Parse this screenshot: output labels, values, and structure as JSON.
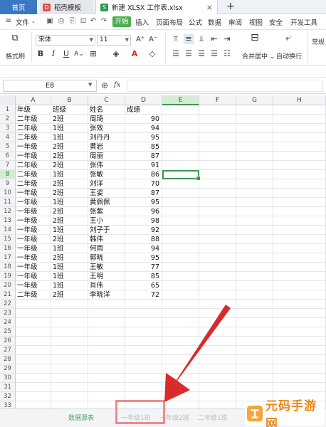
{
  "tabbar": {
    "home": "首页",
    "template": "稻壳模板",
    "file": "新建 XLSX 工作表.xlsx",
    "add": "+"
  },
  "menubar": {
    "file": "文件",
    "start": "开始",
    "items": [
      "插入",
      "页面布局",
      "公式",
      "数据",
      "审阅",
      "视图",
      "安全",
      "开发工具"
    ]
  },
  "ribbon": {
    "format_painter": "格式刷",
    "font_name": "宋体",
    "font_size": "11",
    "merge_center": "合并居中",
    "auto_wrap": "自动换行",
    "normal": "常规"
  },
  "formula_bar": {
    "namebox": "E8",
    "fx": "fx"
  },
  "columns": [
    "A",
    "B",
    "C",
    "D",
    "E",
    "F",
    "G",
    "H"
  ],
  "selected_cell": {
    "col": "E",
    "row": 8
  },
  "rows": [
    {
      "n": "1",
      "a": "年级",
      "b": "班级",
      "c": "姓名",
      "d": "成绩"
    },
    {
      "n": "2",
      "a": "二年级",
      "b": "2班",
      "c": "周琦",
      "d": "90"
    },
    {
      "n": "3",
      "a": "二年级",
      "b": "1班",
      "c": "张效",
      "d": "94"
    },
    {
      "n": "4",
      "a": "二年级",
      "b": "1班",
      "c": "刘丹丹",
      "d": "95"
    },
    {
      "n": "5",
      "a": "一年级",
      "b": "2班",
      "c": "黄岩",
      "d": "85"
    },
    {
      "n": "6",
      "a": "一年级",
      "b": "2班",
      "c": "周丽",
      "d": "87"
    },
    {
      "n": "7",
      "a": "二年级",
      "b": "2班",
      "c": "张伟",
      "d": "91"
    },
    {
      "n": "8",
      "a": "二年级",
      "b": "1班",
      "c": "张敏",
      "d": "86"
    },
    {
      "n": "9",
      "a": "二年级",
      "b": "2班",
      "c": "刘洋",
      "d": "70"
    },
    {
      "n": "10",
      "a": "一年级",
      "b": "2班",
      "c": "王姿",
      "d": "87"
    },
    {
      "n": "11",
      "a": "一年级",
      "b": "1班",
      "c": "黄佩佩",
      "d": "95"
    },
    {
      "n": "12",
      "a": "一年级",
      "b": "2班",
      "c": "张紫",
      "d": "96"
    },
    {
      "n": "13",
      "a": "一年级",
      "b": "2班",
      "c": "王小",
      "d": "98"
    },
    {
      "n": "14",
      "a": "一年级",
      "b": "1班",
      "c": "刘子于",
      "d": "92"
    },
    {
      "n": "15",
      "a": "一年级",
      "b": "2班",
      "c": "韩伟",
      "d": "88"
    },
    {
      "n": "16",
      "a": "一年级",
      "b": "1班",
      "c": "何雨",
      "d": "94"
    },
    {
      "n": "17",
      "a": "一年级",
      "b": "2班",
      "c": "郭晓",
      "d": "95"
    },
    {
      "n": "18",
      "a": "一年级",
      "b": "1班",
      "c": "王敏",
      "d": "77"
    },
    {
      "n": "19",
      "a": "一年级",
      "b": "1班",
      "c": "王明",
      "d": "85"
    },
    {
      "n": "20",
      "a": "一年级",
      "b": "1班",
      "c": "肖伟",
      "d": "65"
    },
    {
      "n": "21",
      "a": "二年级",
      "b": "2班",
      "c": "李晓洋",
      "d": "72"
    },
    {
      "n": "22"
    },
    {
      "n": "23"
    },
    {
      "n": "24"
    },
    {
      "n": "25"
    },
    {
      "n": "26"
    },
    {
      "n": "27"
    },
    {
      "n": "28"
    },
    {
      "n": "29"
    },
    {
      "n": "30"
    },
    {
      "n": "31"
    },
    {
      "n": "32"
    },
    {
      "n": "33"
    }
  ],
  "sheet_tabs": [
    "数据源表",
    "一年级1班",
    "一年级2班",
    "二年级1班"
  ],
  "active_sheet": "数据源表",
  "watermark": "元码手游网",
  "colors": {
    "accent_green": "#4caf50",
    "selection_green": "#3a9a4a",
    "home_tab_blue": "#3b78c3",
    "highlight_red": "#f08a8a",
    "arrow_red": "#d92b2b",
    "watermark_orange": "#e8891c"
  },
  "icons": [
    "doc-icon",
    "excel-icon",
    "hamburger-icon",
    "save-icon",
    "undo-icon",
    "redo-icon",
    "print-icon",
    "search-icon",
    "fx-icon",
    "merge-icon",
    "wrap-icon",
    "arrow-annotation"
  ]
}
